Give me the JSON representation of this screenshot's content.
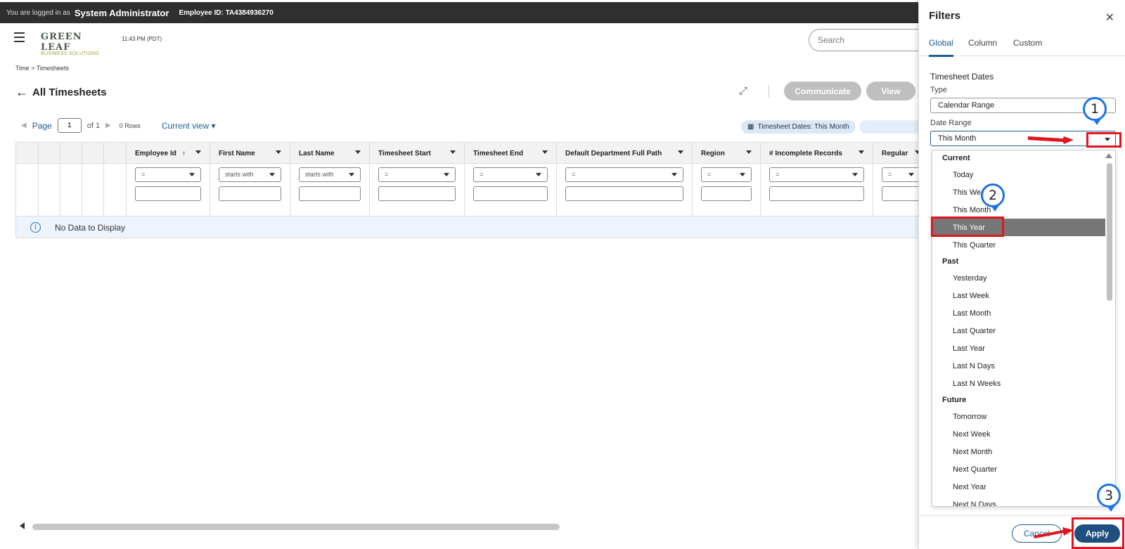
{
  "topbar": {
    "logged_in_as": "You are logged in as",
    "user": "System Administrator",
    "employee_id": "Employee ID: TA4384936270"
  },
  "header": {
    "logo_line1": "GREEN LEAF",
    "logo_line2": "BUSINESS SOLUTIONS",
    "time": "11:43 PM (PDT)",
    "search_placeholder": "Search"
  },
  "breadcrumb": "Time  >  Timesheets",
  "page_title": "All Timesheets",
  "buttons": {
    "communicate": "Communicate",
    "view": "View"
  },
  "pager": {
    "page_label": "Page",
    "page_value": "1",
    "of_label": "of 1",
    "rows": "0 Rows",
    "current_view": "Current view"
  },
  "chip": {
    "label": "Timesheet Dates: This Month"
  },
  "grid": {
    "columns": [
      {
        "label": "Employee Id",
        "op": "=",
        "sort": "↑"
      },
      {
        "label": "First Name",
        "op": "starts with"
      },
      {
        "label": "Last Name",
        "op": "starts with"
      },
      {
        "label": "Timesheet Start",
        "op": "="
      },
      {
        "label": "Timesheet End",
        "op": "="
      },
      {
        "label": "Default Department Full Path",
        "op": "="
      },
      {
        "label": "Region",
        "op": "="
      },
      {
        "label": "# Incomplete Records",
        "op": "="
      },
      {
        "label": "Regular",
        "op": "="
      }
    ],
    "no_data": "No Data to Display"
  },
  "filters": {
    "title": "Filters",
    "tabs": [
      "Global",
      "Column",
      "Custom"
    ],
    "section": "Timesheet Dates",
    "type_label": "Type",
    "type_value": "Calendar Range",
    "range_label": "Date Range",
    "range_value": "This Month",
    "groups": [
      {
        "name": "Current",
        "options": [
          "Today",
          "This Week",
          "This Month",
          "This Year",
          "This Quarter"
        ]
      },
      {
        "name": "Past",
        "options": [
          "Yesterday",
          "Last Week",
          "Last Month",
          "Last Quarter",
          "Last Year",
          "Last N Days",
          "Last N Weeks"
        ]
      },
      {
        "name": "Future",
        "options": [
          "Tomorrow",
          "Next Week",
          "Next Month",
          "Next Quarter",
          "Next Year",
          "Next N Days"
        ]
      }
    ],
    "selected_option": "This Year",
    "cancel": "Cancel",
    "apply": "Apply"
  },
  "annotations": {
    "marker1": "1",
    "marker2": "2",
    "marker3": "3"
  },
  "colors": {
    "accent": "#1f5c99",
    "annotation_red": "#e0161e",
    "annotation_blue": "#1e73e8"
  }
}
